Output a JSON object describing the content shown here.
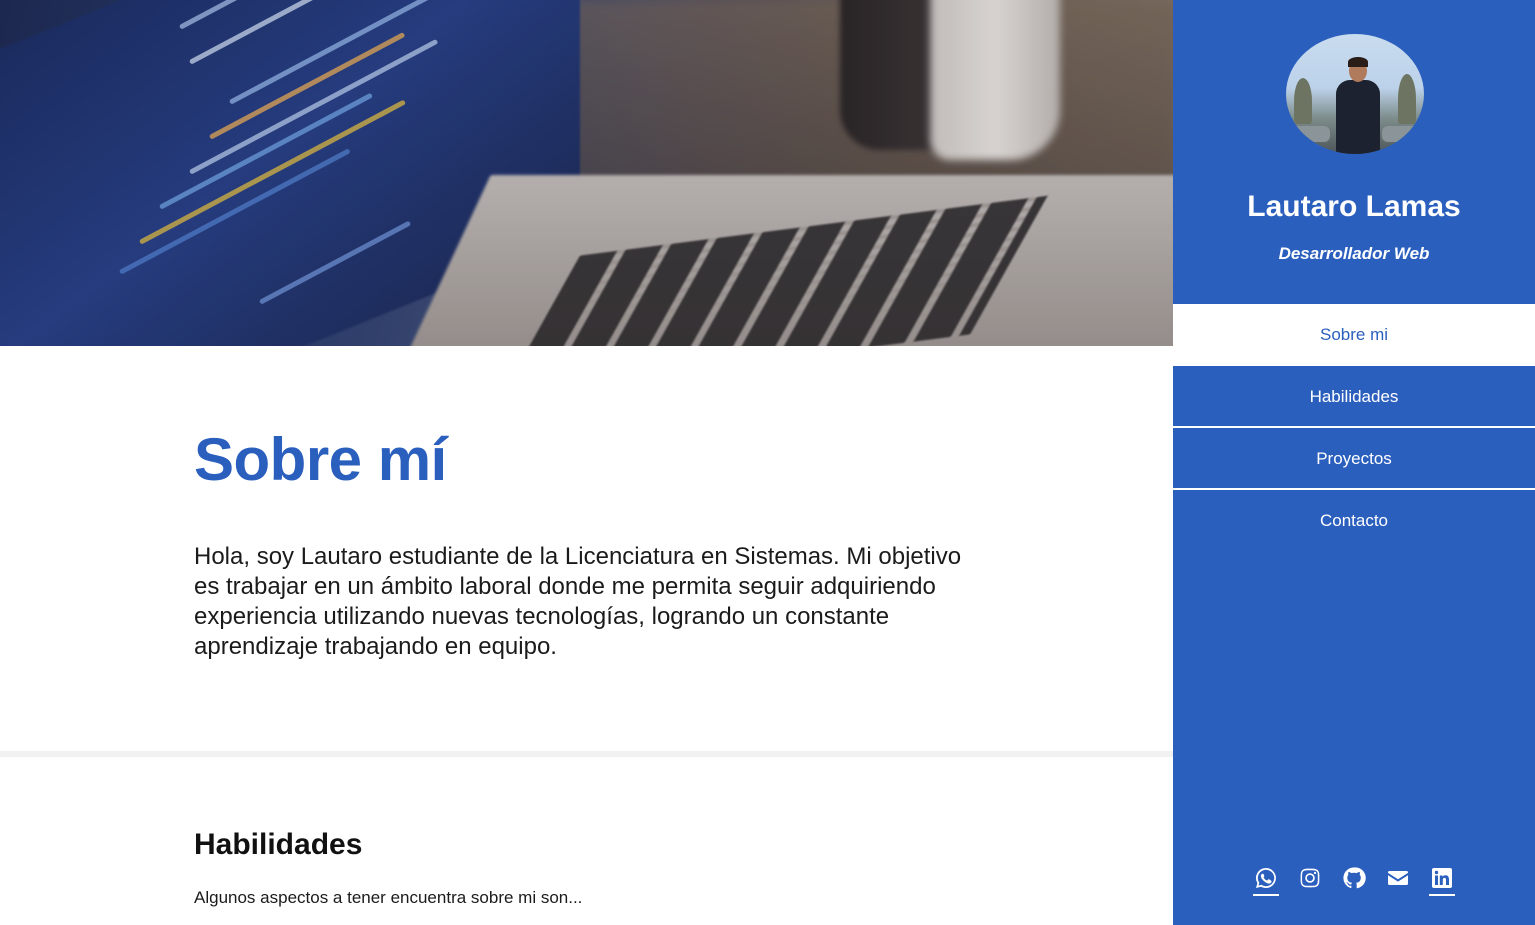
{
  "hero": {
    "image": "laptop-with-code-photo"
  },
  "about": {
    "title": "Sobre mí",
    "text": "Hola, soy Lautaro estudiante de la Licenciatura en Sistemas. Mi objetivo es trabajar en un ámbito laboral donde me permita seguir adquiriendo experiencia utilizando nuevas tecnologías, logrando un constante aprendizaje trabajando en equipo."
  },
  "skills": {
    "title": "Habilidades",
    "subtitle": "Algunos aspectos a tener encuentra sobre mi son..."
  },
  "sidebar": {
    "name": "Lautaro Lamas",
    "role": "Desarrollador Web",
    "avatar": "profile-photo",
    "nav": [
      {
        "label": "Sobre mi",
        "active": true
      },
      {
        "label": "Habilidades",
        "active": false
      },
      {
        "label": "Proyectos",
        "active": false
      },
      {
        "label": "Contacto",
        "active": false
      }
    ],
    "social": [
      "whatsapp-icon",
      "instagram-icon",
      "github-icon",
      "envelope-icon",
      "linkedin-icon"
    ]
  },
  "colors": {
    "accent": "#2b5fbe",
    "text": "#1b1b1b",
    "divider": "#f1f1f1"
  }
}
